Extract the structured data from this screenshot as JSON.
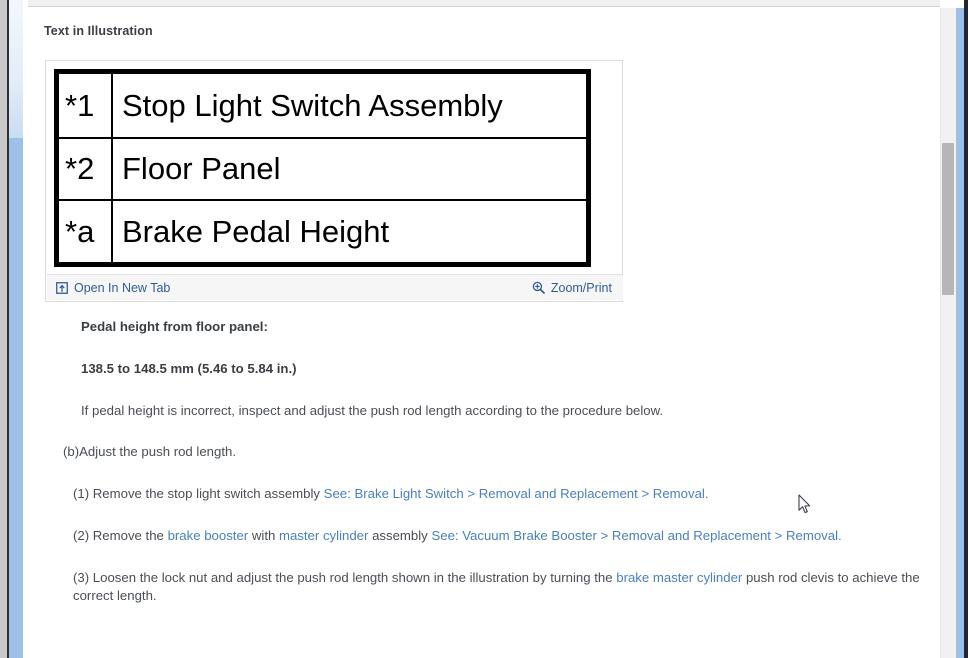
{
  "section": {
    "heading": "Text in Illustration"
  },
  "illustration": {
    "rows": [
      {
        "key": "*1",
        "value": "Stop Light Switch Assembly"
      },
      {
        "key": "*2",
        "value": "Floor Panel"
      },
      {
        "key": "*a",
        "value": "Brake Pedal Height"
      }
    ],
    "toolbar": {
      "open_new_tab_label": "Open In New Tab",
      "open_new_tab_icon": "external-link-icon",
      "zoom_print_label": "Zoom/Print",
      "zoom_print_icon": "magnifier-plus-icon"
    }
  },
  "body": {
    "spec_label": "Pedal height from floor panel:",
    "spec_value": "138.5 to 148.5 mm (5.46 to 5.84 in.)",
    "note": "If pedal height is incorrect, inspect and adjust the push rod length according to the procedure below.",
    "step_b": "(b)Adjust the push rod length.",
    "step_1_pre": "(1) Remove the stop light switch assembly ",
    "step_1_link": "See: Brake Light Switch > Removal and Replacement > Removal.",
    "step_2_pre": "(2) Remove the ",
    "step_2_link1": "brake booster",
    "step_2_mid1": " with ",
    "step_2_link2": "master cylinder",
    "step_2_mid2": " assembly ",
    "step_2_link3": "See: Vacuum Brake Booster > Removal and Replacement > Removal.",
    "step_3_pre": "(3) Loosen the lock nut and adjust the push rod length shown in the illustration by turning the ",
    "step_3_link": "brake master cylinder",
    "step_3_post": " push rod clevis to achieve the correct length."
  },
  "colors": {
    "link": "#4a7fc1",
    "tool_link": "#2f5c9e",
    "text": "#4a4f55",
    "heading": "#3a3f44",
    "panel_border": "#dcdcdc",
    "toolbar_bg": "#f6f6f6",
    "scrollbar_thumb": "#b6b6b6",
    "chrome_blue": "#9cc0e7"
  }
}
